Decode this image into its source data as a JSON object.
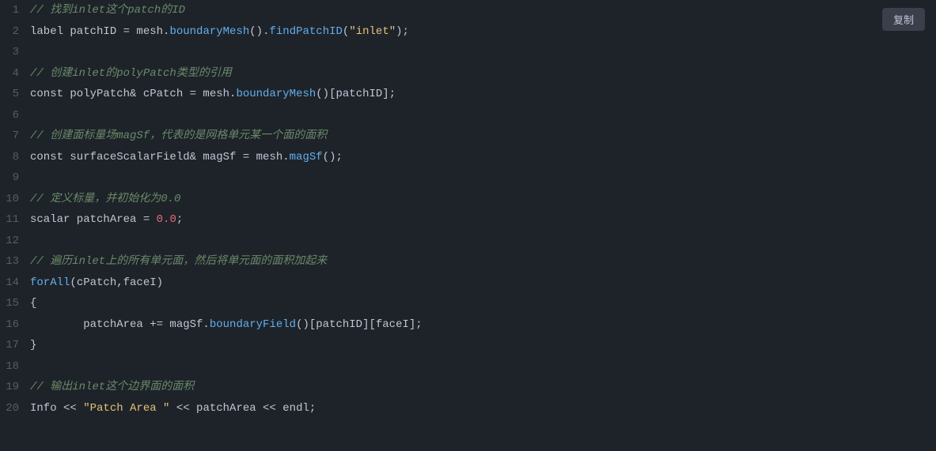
{
  "ui": {
    "copy_button_label": "复制",
    "background_color": "#1e2329"
  },
  "lines": [
    {
      "num": 1,
      "tokens": [
        {
          "text": "// 找到inlet这个patch的ID",
          "cls": "c-comment-cn"
        }
      ]
    },
    {
      "num": 2,
      "tokens": [
        {
          "text": "label patchID = mesh.",
          "cls": "c-var"
        },
        {
          "text": "boundaryMesh",
          "cls": "c-func"
        },
        {
          "text": "().",
          "cls": "c-var"
        },
        {
          "text": "findPatchID",
          "cls": "c-func"
        },
        {
          "text": "(",
          "cls": "c-var"
        },
        {
          "text": "\"inlet\"",
          "cls": "c-string"
        },
        {
          "text": ");",
          "cls": "c-var"
        }
      ]
    },
    {
      "num": 3,
      "tokens": []
    },
    {
      "num": 4,
      "tokens": [
        {
          "text": "// 创建inlet的polyPatch类型的引用",
          "cls": "c-comment-cn"
        }
      ]
    },
    {
      "num": 5,
      "tokens": [
        {
          "text": "const polyPatch& cPatch = mesh.",
          "cls": "c-var"
        },
        {
          "text": "boundaryMesh",
          "cls": "c-func"
        },
        {
          "text": "()[patchID];",
          "cls": "c-var"
        }
      ]
    },
    {
      "num": 6,
      "tokens": []
    },
    {
      "num": 7,
      "tokens": [
        {
          "text": "// 创建面标量场magSf，代表的是网格单元某一个面的面积",
          "cls": "c-comment-cn"
        }
      ]
    },
    {
      "num": 8,
      "tokens": [
        {
          "text": "const surfaceScalarField& magSf = mesh.",
          "cls": "c-var"
        },
        {
          "text": "magSf",
          "cls": "c-func"
        },
        {
          "text": "();",
          "cls": "c-var"
        }
      ]
    },
    {
      "num": 9,
      "tokens": []
    },
    {
      "num": 10,
      "tokens": [
        {
          "text": "// 定义标量，并初始化为0.0",
          "cls": "c-comment-cn"
        }
      ]
    },
    {
      "num": 11,
      "tokens": [
        {
          "text": "scalar patchArea = ",
          "cls": "c-var"
        },
        {
          "text": "0.0",
          "cls": "c-number"
        },
        {
          "text": ";",
          "cls": "c-var"
        }
      ]
    },
    {
      "num": 12,
      "tokens": []
    },
    {
      "num": 13,
      "tokens": [
        {
          "text": "// 遍历inlet上的所有单元面，然后将单元面的面积加起来",
          "cls": "c-comment-cn"
        }
      ]
    },
    {
      "num": 14,
      "tokens": [
        {
          "text": "forAll",
          "cls": "c-func"
        },
        {
          "text": "(cPatch,faceI)",
          "cls": "c-var"
        }
      ]
    },
    {
      "num": 15,
      "tokens": [
        {
          "text": "{",
          "cls": "c-var"
        }
      ]
    },
    {
      "num": 16,
      "tokens": [
        {
          "text": "        patchArea += magSf.",
          "cls": "c-var"
        },
        {
          "text": "boundaryField",
          "cls": "c-func"
        },
        {
          "text": "()[patchID][faceI];",
          "cls": "c-var"
        }
      ]
    },
    {
      "num": 17,
      "tokens": [
        {
          "text": "}",
          "cls": "c-var"
        }
      ]
    },
    {
      "num": 18,
      "tokens": []
    },
    {
      "num": 19,
      "tokens": [
        {
          "text": "// 输出inlet这个边界面的面积",
          "cls": "c-comment-cn"
        }
      ]
    },
    {
      "num": 20,
      "tokens": [
        {
          "text": "Info",
          "cls": "c-info"
        },
        {
          "text": " << ",
          "cls": "c-var"
        },
        {
          "text": "\"Patch Area \"",
          "cls": "c-string"
        },
        {
          "text": " << patchArea << endl;",
          "cls": "c-var"
        }
      ]
    }
  ]
}
